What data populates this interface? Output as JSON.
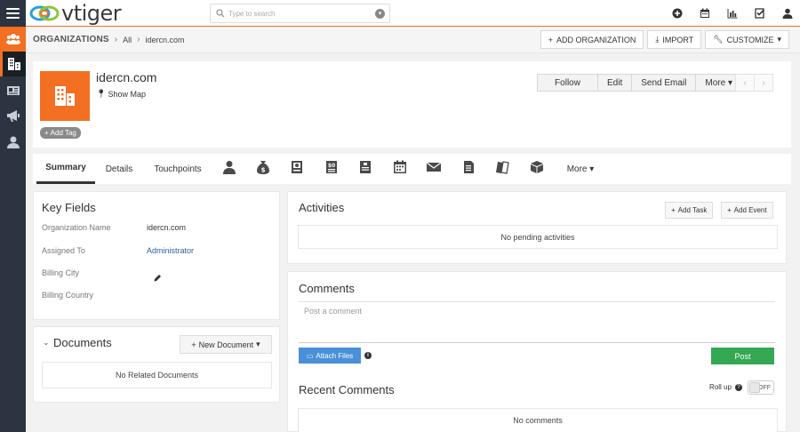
{
  "app": {
    "logo_text": "vtiger",
    "search_placeholder": "Type to search"
  },
  "breadcrumb": {
    "module": "ORGANIZATIONS",
    "filter": "All",
    "record": "idercn.com"
  },
  "header_buttons": {
    "add_organization": "ADD ORGANIZATION",
    "import": "IMPORT",
    "customize": "CUSTOMIZE"
  },
  "record": {
    "name": "idercn.com",
    "show_map": "Show Map",
    "add_tag": "Add Tag",
    "actions": {
      "follow": "Follow",
      "edit": "Edit",
      "send_email": "Send Email",
      "more": "More"
    }
  },
  "tabs": {
    "summary": "Summary",
    "details": "Details",
    "touchpoints": "Touchpoints",
    "more": "More"
  },
  "key_fields": {
    "title": "Key Fields",
    "rows": [
      {
        "label": "Organization Name",
        "value": "idercn.com"
      },
      {
        "label": "Assigned To",
        "value": "Administrator"
      },
      {
        "label": "Billing City",
        "value": ""
      },
      {
        "label": "Billing Country",
        "value": ""
      }
    ]
  },
  "documents": {
    "title": "Documents",
    "new_button": "New Document",
    "empty": "No Related Documents"
  },
  "activities": {
    "title": "Activities",
    "add_task": "Add Task",
    "add_event": "Add Event",
    "empty": "No pending activities"
  },
  "comments": {
    "title": "Comments",
    "placeholder": "Post a comment",
    "attach": "Attach Files",
    "post": "Post",
    "recent_title": "Recent Comments",
    "rollup": "Roll up",
    "toggle": "OFF",
    "empty": "No comments"
  },
  "colors": {
    "accent": "#f36f21",
    "sidebar": "#2b3440",
    "attach_button": "#4a90d9",
    "post_button": "#34a853"
  },
  "icons": {
    "sidebar": [
      "menu-icon",
      "contacts-icon",
      "organizations-icon",
      "id-card-icon",
      "megaphone-icon",
      "user-icon"
    ],
    "topbar": [
      "plus-circle-icon",
      "calendar-icon",
      "bar-chart-icon",
      "checkbox-icon",
      "user-icon"
    ],
    "related": [
      "contact-icon",
      "money-bag-icon",
      "ticket-icon",
      "quote-icon",
      "invoice-icon",
      "calendar-icon",
      "email-icon",
      "document-icon",
      "products-icon",
      "box-icon"
    ]
  }
}
